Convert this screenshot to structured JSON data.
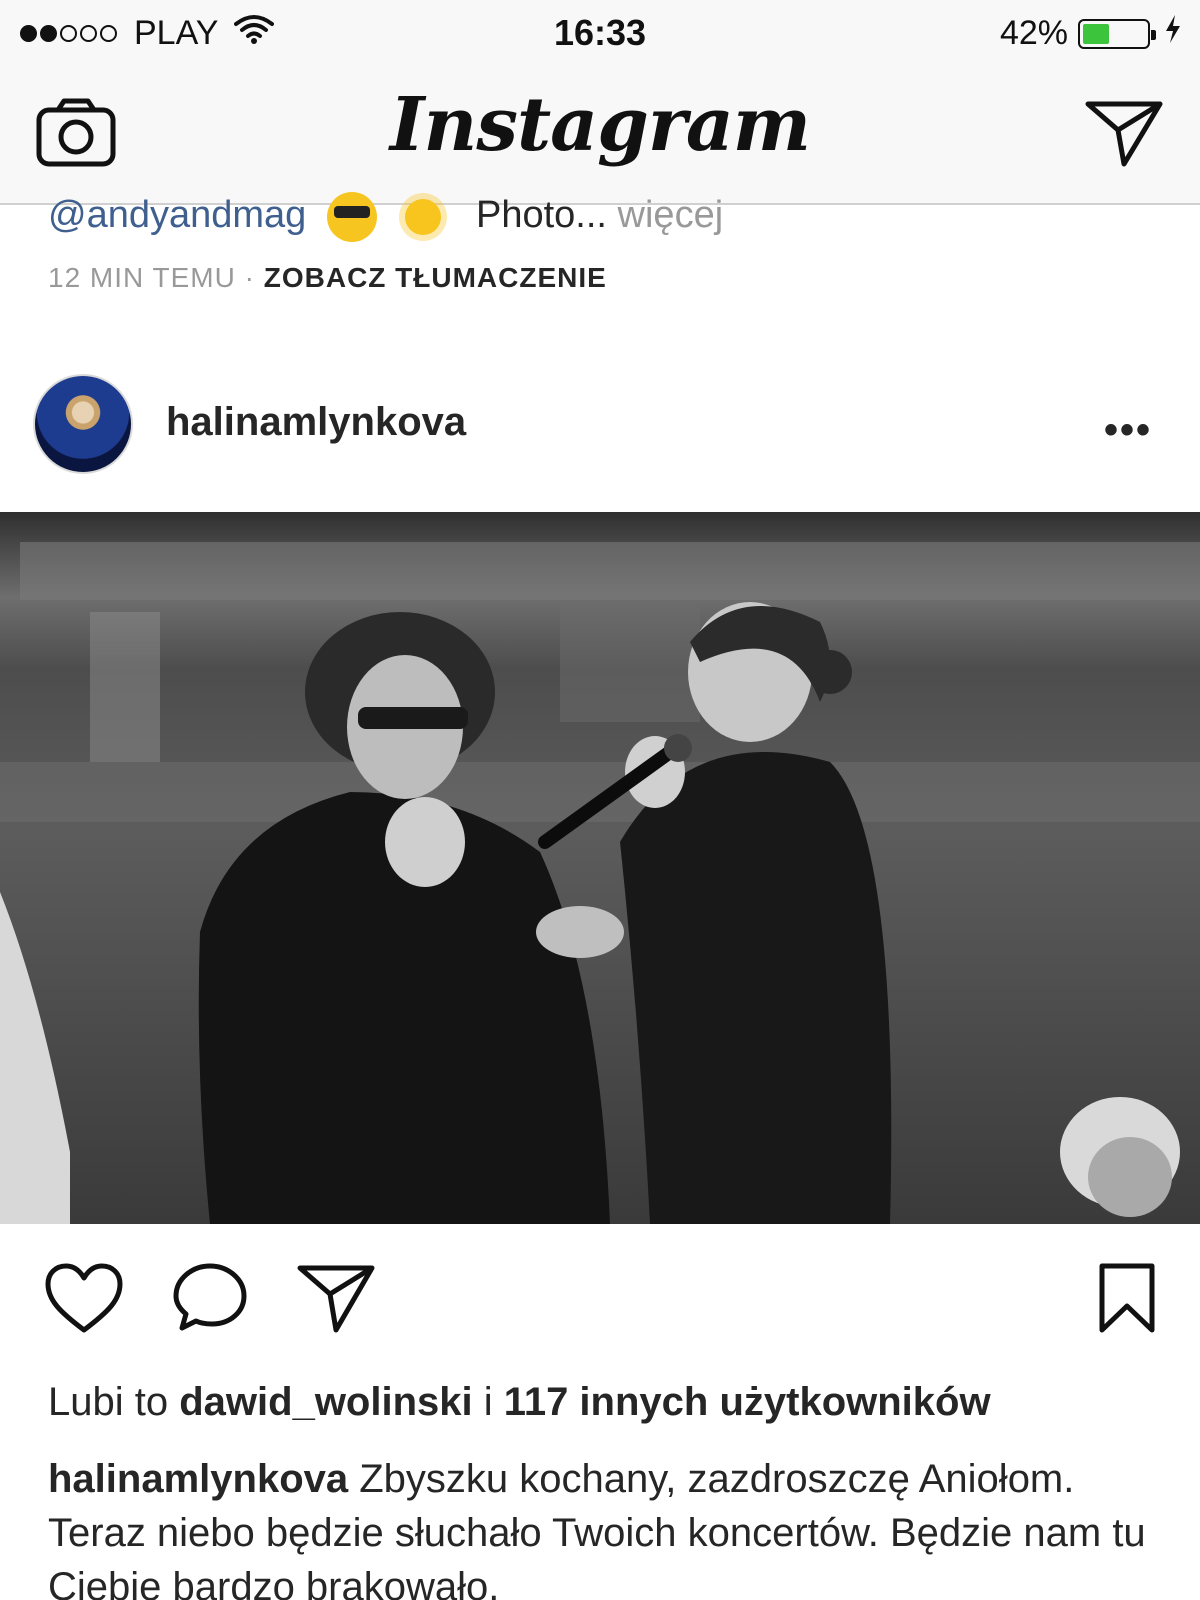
{
  "status_bar": {
    "carrier": "PLAY",
    "signal_bars_filled": 2,
    "signal_bars_total": 5,
    "time": "16:33",
    "battery_percent_label": "42%",
    "battery_level": 0.42,
    "battery_color": "#3dc43d"
  },
  "nav": {
    "logo_text": "Instagram",
    "left_icon": "camera-icon",
    "right_icon": "direct-message-icon"
  },
  "previous_post": {
    "mention": "@andyandmag",
    "caption_text": "Photo...",
    "more_label": "więcej",
    "time_ago": "12 MIN TEMU",
    "separator": "·",
    "translate_label": "ZOBACZ TŁUMACZENIE"
  },
  "post": {
    "username": "halinamlynkova",
    "more_icon": "more-options-icon",
    "image_icon": "post-photo",
    "likes": {
      "prefix": "Lubi to",
      "first_liker": "dawid_wolinski",
      "joiner": "i",
      "others": "117 innych użytkowników"
    },
    "caption": {
      "author": "halinamlynkova",
      "text": "Zbyszku kochany, zazdroszczę Aniołom. Teraz niebo będzie słuchało Twoich koncertów. Będzie nam tu Ciebie bardzo brakowało."
    },
    "actions": {
      "like_icon": "heart-icon",
      "comment_icon": "comment-icon",
      "share_icon": "share-icon",
      "save_icon": "bookmark-icon"
    }
  },
  "colors": {
    "mention_link": "#3f5f8f",
    "muted_text": "#999999",
    "text": "#262626"
  }
}
